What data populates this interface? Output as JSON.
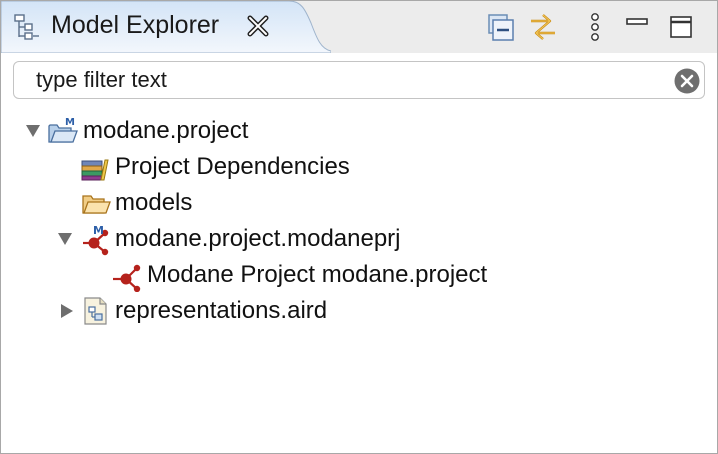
{
  "view": {
    "title": "Model Explorer",
    "icons": {
      "tab": "model-explorer-icon",
      "close": "close-tab-icon",
      "collapse_all": "collapse-all-icon",
      "link_with_editor": "link-with-editor-icon",
      "view_menu": "view-menu-icon",
      "minimize": "minimize-icon",
      "maximize": "maximize-icon"
    }
  },
  "filter": {
    "placeholder": "type filter text",
    "value": "",
    "clear_icon": "clear-icon"
  },
  "tree": {
    "nodes": [
      {
        "label": "modane.project",
        "icon": "project-folder-icon",
        "expanded": true,
        "level": 0
      },
      {
        "label": "Project Dependencies",
        "icon": "library-icon",
        "level": 1
      },
      {
        "label": "models",
        "icon": "folder-icon",
        "level": 1
      },
      {
        "label": "modane.project.modaneprj",
        "icon": "modaneprj-file-icon",
        "expanded": true,
        "level": 1
      },
      {
        "label": "Modane Project modane.project",
        "icon": "modane-project-icon",
        "level": 2
      },
      {
        "label": "representations.aird",
        "icon": "aird-file-icon",
        "expanded": false,
        "level": 1
      }
    ]
  },
  "colors": {
    "tab_gradient_top": "#d6e6f8",
    "tab_gradient_bottom": "#f4f8fc",
    "model_red": "#b5221c",
    "folder_orange": "#e8a33c"
  }
}
